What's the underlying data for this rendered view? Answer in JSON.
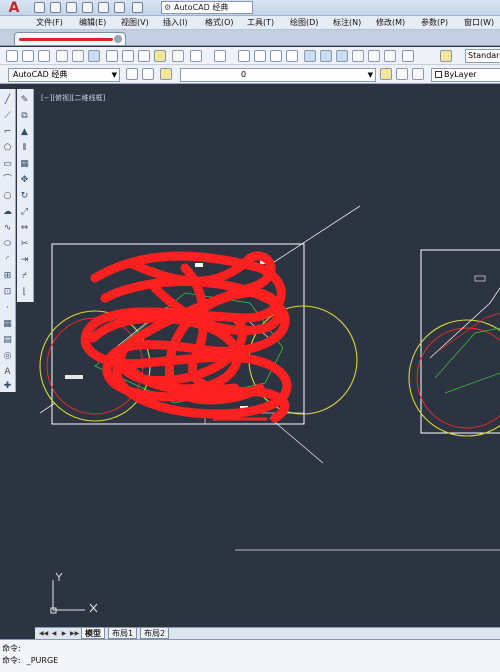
{
  "titlebar": {
    "workspace": "AutoCAD 经典"
  },
  "menubar": {
    "items": [
      "文件(F)",
      "编辑(E)",
      "视图(V)",
      "插入(I)",
      "格式(O)",
      "工具(T)",
      "绘图(D)",
      "标注(N)",
      "修改(M)",
      "参数(P)",
      "窗口(W)"
    ]
  },
  "toolbar": {
    "text_style": "Standard",
    "workspace": "AutoCAD 经典",
    "layer": "0",
    "color": "ByLayer"
  },
  "viewport": {
    "label": "[−][俯视][二维线框]"
  },
  "layout_tabs": [
    "模型",
    "布局1",
    "布局2"
  ],
  "command_line": {
    "lines": [
      {
        "prompt": "命令:",
        "value": ""
      },
      {
        "prompt": "命令:",
        "value": "_PURGE"
      }
    ]
  },
  "colors": {
    "canvas": "#2b3440",
    "scribble": "#ff2020",
    "wheel": "#d6d63a",
    "frame": "#ffffff"
  }
}
